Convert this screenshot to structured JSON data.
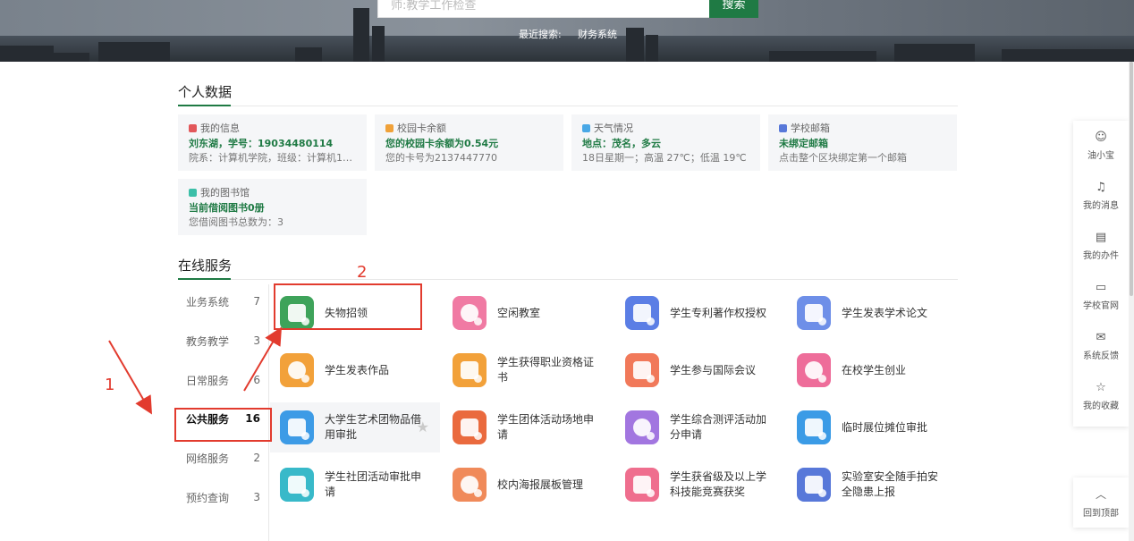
{
  "search": {
    "placeholder": "师:教学工作检查",
    "button": "搜索",
    "recent_label": "最近搜索:",
    "recent_term": "财务系统"
  },
  "personal": {
    "title": "个人数据",
    "cards": [
      {
        "head": "我的信息",
        "main": "刘东湖，学号：19034480114",
        "sub": "院系：计算机学院，班级：计算机19-...",
        "color": "#e2575a"
      },
      {
        "head": "校园卡余额",
        "main": "您的校园卡余额为0.54元",
        "sub": "您的卡号为2137447770",
        "color": "#f0a139"
      },
      {
        "head": "天气情况",
        "main": "地点：茂名，多云",
        "sub": "18日星期一；高温 27℃；低温 19℃",
        "color": "#49a8e6"
      },
      {
        "head": "学校邮箱",
        "main": "未绑定邮箱",
        "sub": "点击整个区块绑定第一个邮箱",
        "color": "#5878d9"
      },
      {
        "head": "我的图书馆",
        "main": "当前借阅图书0册",
        "sub": "您借阅图书总数为：3",
        "color": "#3cbfa8"
      }
    ]
  },
  "online": {
    "title": "在线服务",
    "categories": [
      {
        "name": "业务系统",
        "count": "7"
      },
      {
        "name": "教务教学",
        "count": "3"
      },
      {
        "name": "日常服务",
        "count": "6"
      },
      {
        "name": "公共服务",
        "count": "16"
      },
      {
        "name": "网络服务",
        "count": "2"
      },
      {
        "name": "预约查询",
        "count": "3"
      }
    ],
    "services": [
      {
        "label": "失物招领",
        "color": "#3ea35a"
      },
      {
        "label": "空闲教室",
        "color": "#f07aa3"
      },
      {
        "label": "学生专利著作权授权",
        "color": "#5b7ee5"
      },
      {
        "label": "学生发表学术论文",
        "color": "#6e8fe8"
      },
      {
        "label": "学生发表作品",
        "color": "#f2a13a"
      },
      {
        "label": "学生获得职业资格证书",
        "color": "#f2a13a"
      },
      {
        "label": "学生参与国际会议",
        "color": "#f1795a"
      },
      {
        "label": "在校学生创业",
        "color": "#ee6d9a"
      },
      {
        "label": "大学生艺术团物品借用审批",
        "color": "#3d9be6"
      },
      {
        "label": "学生团体活动场地申请",
        "color": "#ea6a3e"
      },
      {
        "label": "学生综合测评活动加分申请",
        "color": "#a276e0"
      },
      {
        "label": "临时展位摊位审批",
        "color": "#3b9be6"
      },
      {
        "label": "学生社团活动审批申请",
        "color": "#38b9c9"
      },
      {
        "label": "校内海报展板管理",
        "color": "#f08a5a"
      },
      {
        "label": "学生获省级及以上学科技能竞赛获奖",
        "color": "#ef6e8e"
      },
      {
        "label": "实验室安全随手拍安全隐患上报",
        "color": "#5878d9"
      }
    ]
  },
  "sidebar": [
    {
      "label": "油小宝",
      "icon": "assistant-icon"
    },
    {
      "label": "我的消息",
      "icon": "bell-icon"
    },
    {
      "label": "我的办件",
      "icon": "document-icon"
    },
    {
      "label": "学校官网",
      "icon": "monitor-icon"
    },
    {
      "label": "系统反馈",
      "icon": "feedback-icon"
    },
    {
      "label": "我的收藏",
      "icon": "star-icon"
    }
  ],
  "back_to_top": "回到顶部",
  "annotations": {
    "one": "1",
    "two": "2"
  }
}
